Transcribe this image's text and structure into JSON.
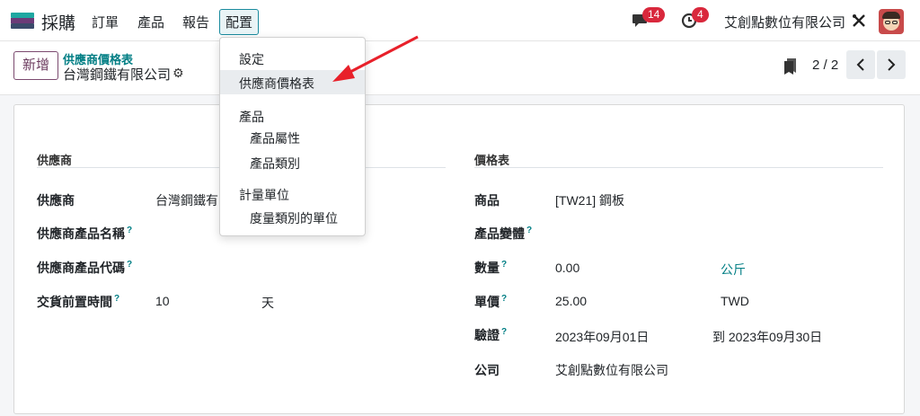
{
  "navbar": {
    "app_title": "採購",
    "menu": [
      "訂單",
      "產品",
      "報告",
      "配置"
    ],
    "messages_count": "14",
    "activities_count": "4",
    "company": "艾創點數位有限公司"
  },
  "control": {
    "new_label": "新增",
    "breadcrumb": "供應商價格表",
    "record_title": "台灣鋼鐵有限公司",
    "pager": "2 / 2"
  },
  "dropdown": {
    "settings": "設定",
    "pricelist": "供應商價格表",
    "products_header": "產品",
    "attributes": "產品屬性",
    "categories": "產品類別",
    "uom_header": "計量單位",
    "uom_categories": "度量類別的單位"
  },
  "form": {
    "vendor_section": "供應商",
    "vendor_label": "供應商",
    "vendor_value": "台灣鋼鐵有",
    "vendor_product_name_label": "供應商產品名稱",
    "vendor_product_code_label": "供應商產品代碼",
    "lead_time_label": "交貨前置時間",
    "lead_time_value": "10",
    "lead_time_unit": "天",
    "pricelist_section": "價格表",
    "product_label": "商品",
    "product_value": "[TW21] 鋼板",
    "variant_label": "產品變體",
    "quantity_label": "數量",
    "quantity_value": "0.00",
    "quantity_uom": "公斤",
    "price_label": "單價",
    "price_value": "25.00",
    "currency": "TWD",
    "validity_label": "驗證",
    "validity_from": "2023年09月01日",
    "validity_to": "到 2023年09月30日",
    "company_label": "公司",
    "company_value": "艾創點數位有限公司"
  },
  "colors": {
    "accent": "#017e84",
    "brand": "#6c3b78",
    "badge": "#d9283c",
    "arrow": "#e8202a"
  }
}
